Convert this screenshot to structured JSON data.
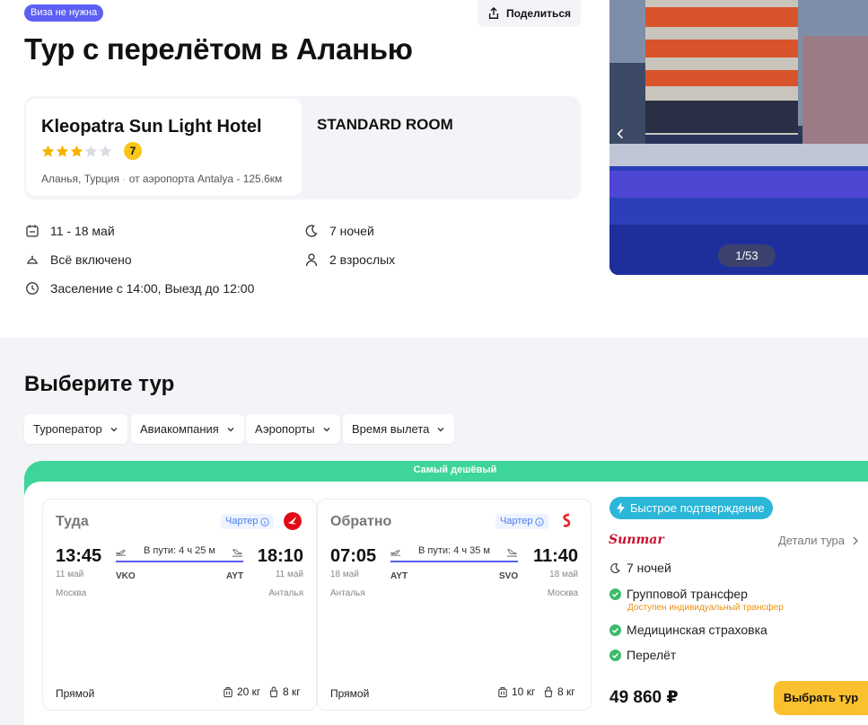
{
  "header": {
    "visa_badge": "Виза не нужна",
    "share_label": "Поделиться",
    "title": "Тур с перелётом в Аланью"
  },
  "hotel": {
    "name": "Kleopatra Sun Light Hotel",
    "stars": 3,
    "stars_max": 5,
    "rating": "7",
    "location": "Аланья, Турция",
    "airport_distance": "от аэропорта Antalya - 125.6км",
    "room_type": "STANDARD ROOM"
  },
  "trip_info": {
    "dates": "11 - 18 май",
    "nights": "7 ночей",
    "meal": "Всё включено",
    "guests": "2 взрослых",
    "checkin": "Заселение с 14:00, Выезд до 12:00"
  },
  "gallery": {
    "counter": "1/53",
    "prev_icon": "chevron-left-icon"
  },
  "section": {
    "title": "Выберите тур",
    "filters": [
      "Туроператор",
      "Авиакомпания",
      "Аэропорты",
      "Время вылета"
    ]
  },
  "offer": {
    "cheapest_label": "Самый дешёвый",
    "outbound": {
      "direction": "Туда",
      "charter": "Чартер",
      "dep_time": "13:45",
      "dep_date": "11 май",
      "dep_city": "Москва",
      "dep_code": "VKO",
      "duration": "В пути: 4 ч 25 м",
      "arr_time": "18:10",
      "arr_date": "11 май",
      "arr_city": "Анталья",
      "arr_code": "AYT",
      "type": "Прямой",
      "baggage": "20 кг",
      "hand_luggage": "8 кг",
      "airline_color": "#e30a17"
    },
    "inbound": {
      "direction": "Обратно",
      "charter": "Чартер",
      "dep_time": "07:05",
      "dep_date": "18 май",
      "dep_city": "Анталья",
      "dep_code": "AYT",
      "duration": "В пути: 4 ч 35 м",
      "arr_time": "11:40",
      "arr_date": "18 май",
      "arr_city": "Москва",
      "arr_code": "SVO",
      "type": "Прямой",
      "baggage": "10 кг",
      "hand_luggage": "8 кг",
      "airline_color": "#e8202a"
    },
    "fast_confirm": "Быстрое подтверждение",
    "operator_logo": "Sunmar",
    "details_label": "Детали тура",
    "nights": "7 ночей",
    "features": [
      "Групповой трансфер",
      "Медицинская страховка",
      "Перелёт"
    ],
    "transfer_note": "Доступен индивидуальный трансфер",
    "price": "49 860 ₽",
    "choose_label": "Выбрать тур"
  },
  "colors": {
    "accent": "#5c5ff2",
    "cheapest": "#3dd598",
    "fast_badge": "#2ab7d8",
    "button": "#fbc02d",
    "check": "#3dbb6d"
  }
}
